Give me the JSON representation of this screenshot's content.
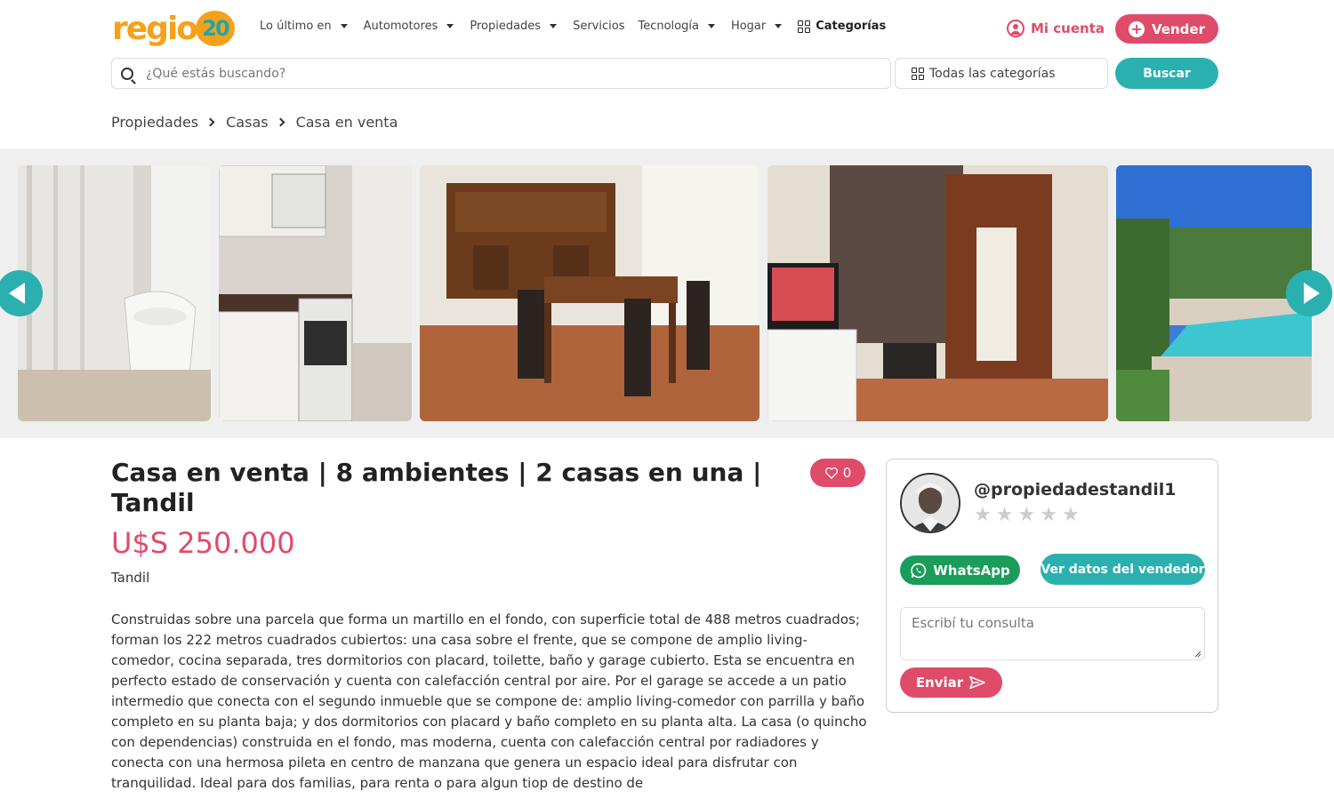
{
  "brand": {
    "logo_text": "region",
    "logo_number": "20"
  },
  "nav": {
    "items": [
      {
        "label": "Lo último en",
        "has_caret": true
      },
      {
        "label": "Automotores",
        "has_caret": true
      },
      {
        "label": "Propiedades",
        "has_caret": true
      },
      {
        "label": "Servicios",
        "has_caret": false
      },
      {
        "label": "Tecnología",
        "has_caret": true
      },
      {
        "label": "Hogar",
        "has_caret": true
      }
    ],
    "categories_label": "Categorías",
    "account_label": "Mi cuenta",
    "sell_label": "Vender"
  },
  "search": {
    "placeholder": "¿Qué estás buscando?",
    "category_value": "Todas las categorías",
    "button_label": "Buscar"
  },
  "breadcrumb": [
    "Propiedades",
    "Casas",
    "Casa en venta"
  ],
  "gallery": {
    "photos": [
      {
        "icon": "bathroom-photo"
      },
      {
        "icon": "kitchen-photo"
      },
      {
        "icon": "dining-room-photo"
      },
      {
        "icon": "living-room-photo"
      },
      {
        "icon": "pool-photo"
      }
    ]
  },
  "listing": {
    "title": "Casa en venta | 8 ambientes | 2 casas en una | Tandil",
    "likes": "0",
    "price": "U$S 250.000",
    "location": "Tandil",
    "description": "Construidas sobre una parcela que forma un martillo en el fondo, con superficie total de 488 metros cuadrados; forman los 222 metros cuadrados cubiertos: una casa sobre el frente, que se compone de amplio living-comedor, cocina separada, tres dormitorios con placard, toilette, baño y garage cubierto. Esta se encuentra en perfecto estado de conservación y cuenta con calefacción central por aire. Por el garage se accede a un patio intermedio que conecta con el segundo inmueble que se compone de: amplio living-comedor con parrilla y baño completo en su planta baja; y dos dormitorios con placard y baño completo en su planta alta. La casa (o quincho con dependencias) construida en el fondo, mas moderna, cuenta con calefacción central por radiadores y conecta con una hermosa pileta en centro de manzana que genera un espacio ideal para disfrutar con tranquilidad. Ideal para dos familias, para renta o para algun tiop de destino de"
  },
  "seller": {
    "username": "@propiedadestandil1",
    "rating": 0,
    "max_rating": 5,
    "whatsapp_label": "WhatsApp",
    "details_label": "Ver datos del vendedor",
    "message_placeholder": "Escribí tu consulta",
    "send_label": "Enviar"
  },
  "colors": {
    "brand_orange": "#f5a11a",
    "accent_pink": "#e04b6a",
    "accent_teal": "#2bb0b0",
    "whatsapp_green": "#1a9c5b"
  }
}
